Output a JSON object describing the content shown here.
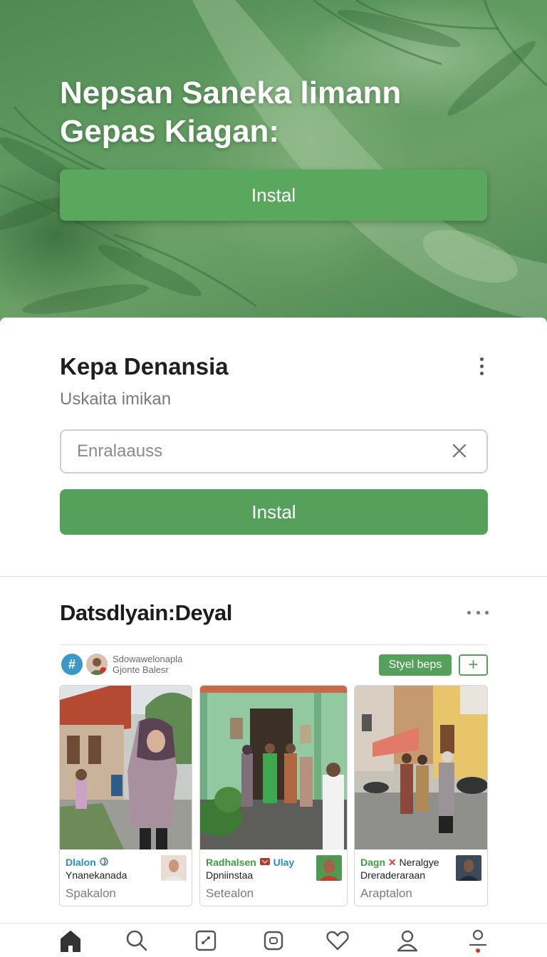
{
  "hero": {
    "title_line1": "Nepsan Saneka limann",
    "title_line2": "Gepas Kiagan:",
    "button_label": "Instal"
  },
  "card": {
    "title": "Kepa Denansia",
    "subtitle": "Uskaita imikan",
    "input_placeholder": "Enralaauss",
    "button_label": "Instal"
  },
  "section": {
    "title": "Datsdlyain:Deyal",
    "meta_icon": "#",
    "meta_line1": "Sdowawelonapla",
    "meta_line2": "Gjonte Balesr",
    "style_button": "Styel beps",
    "add_button": "+"
  },
  "tiles": [
    {
      "name": "Dlalon",
      "name_color": "#2a8fbf",
      "sub": "Ynanekanada",
      "tag": "Spakalon"
    },
    {
      "name": "Radhalsen",
      "name_extra": "Ulay",
      "name_color": "#3f9b45",
      "extra_color": "#2a8fbf",
      "sub": "Dpniinstaa",
      "tag": "Setealon"
    },
    {
      "name": "Dagn",
      "name_extra": "Neralgye",
      "name_color": "#3f9b45",
      "extra_color": "#222222",
      "sub": "Dreraderaraan",
      "tag": "Araptalon"
    }
  ],
  "nav": {
    "items": [
      "home-icon",
      "search-icon",
      "share-icon",
      "camera-icon",
      "heart-icon",
      "profile-icon",
      "account-icon"
    ],
    "active": "home-icon"
  },
  "colors": {
    "accent_green": "#55a05a",
    "hero_green": "#5f9a60",
    "link_blue": "#2a8fbf"
  }
}
